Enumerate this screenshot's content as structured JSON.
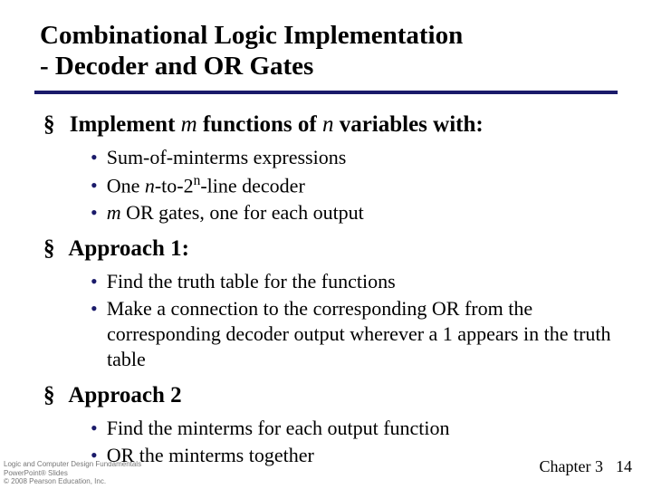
{
  "title_line1": "Combinational Logic Implementation",
  "title_line2": "- Decoder and OR Gates",
  "sections": [
    {
      "heading_pre": "Implement ",
      "heading_m": "m",
      "heading_mid": " functions of ",
      "heading_n": "n",
      "heading_post": " variables with:",
      "items": [
        {
          "text": "Sum-of-minterms expressions"
        },
        {
          "pre": "One ",
          "it1": "n",
          "mid": "-to-2",
          "sup": "n",
          "post": "-line decoder"
        },
        {
          "it1": "m",
          "post": " OR gates, one for each output"
        }
      ]
    },
    {
      "heading": "Approach 1:",
      "items": [
        {
          "text": "Find the truth table for the functions"
        },
        {
          "text": "Make a connection to the corresponding OR from the corresponding decoder output wherever a 1 appears in the truth table"
        }
      ]
    },
    {
      "heading": "Approach 2",
      "items": [
        {
          "text": "Find the minterms for each output function"
        },
        {
          "text": "OR the minterms together"
        }
      ]
    }
  ],
  "footer": {
    "line1": "Logic and Computer Design Fundamentals",
    "line2": "PowerPoint® Slides",
    "line3": "© 2008 Pearson Education, Inc.",
    "chapter": "Chapter 3",
    "page": "14"
  }
}
